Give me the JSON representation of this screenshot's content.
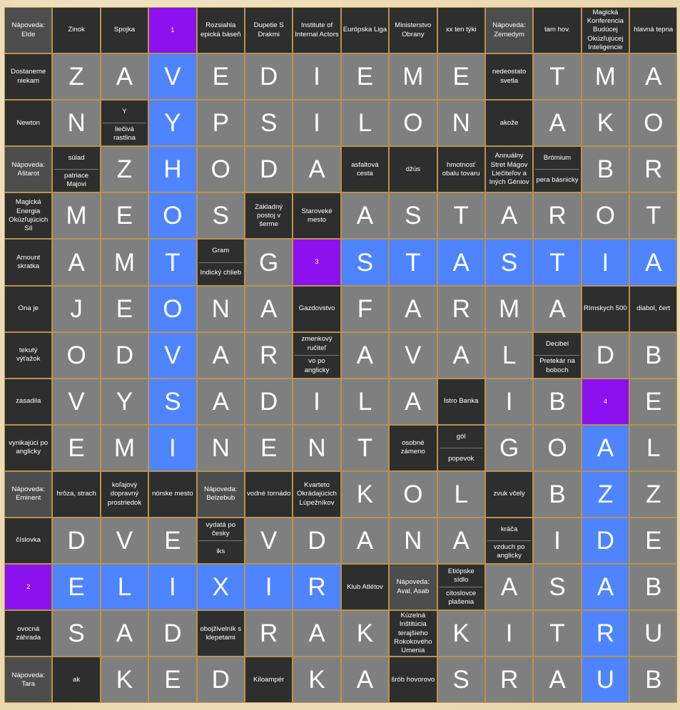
{
  "title": "",
  "rows": [
    [
      {
        "t": "hint",
        "text": "Nápoveda: Elde"
      },
      {
        "t": "clue",
        "text": "Zinok"
      },
      {
        "t": "clue",
        "text": "Spojka"
      },
      {
        "t": "num",
        "text": "1"
      },
      {
        "t": "clue",
        "text": "Rozsiahla epická báseň"
      },
      {
        "t": "clue",
        "text": "Dupetie S Drakmi"
      },
      {
        "t": "clue",
        "text": "Institute of Internal Actors"
      },
      {
        "t": "clue",
        "text": "Európska Liga"
      },
      {
        "t": "clue",
        "text": "Ministerstvo Obrany"
      },
      {
        "t": "clue",
        "text": "xx ten týki"
      },
      {
        "t": "hint",
        "text": "Nápoveda: Zemedym"
      },
      {
        "t": "clue",
        "text": "tam hov."
      },
      {
        "t": "clue",
        "text": "Magická Konferencia Budúcej Okúzľujúcej Inteligencie"
      },
      {
        "t": "clue",
        "text": "hlavná tepna"
      }
    ],
    [
      {
        "t": "clue",
        "text": "Dostaneme niekam"
      },
      {
        "t": "letter",
        "text": "Z"
      },
      {
        "t": "letter",
        "text": "A"
      },
      {
        "t": "letter",
        "text": "V",
        "hl": true
      },
      {
        "t": "letter",
        "text": "E"
      },
      {
        "t": "letter",
        "text": "D"
      },
      {
        "t": "letter",
        "text": "I"
      },
      {
        "t": "letter",
        "text": "E"
      },
      {
        "t": "letter",
        "text": "M"
      },
      {
        "t": "letter",
        "text": "E"
      },
      {
        "t": "clue",
        "text": "nedeostato svetla"
      },
      {
        "t": "letter",
        "text": "T"
      },
      {
        "t": "letter",
        "text": "M"
      },
      {
        "t": "letter",
        "text": "A"
      }
    ],
    [
      {
        "t": "clue",
        "text": "Newton"
      },
      {
        "t": "letter",
        "text": "N"
      },
      {
        "t": "split",
        "top": "Y",
        "bottom": "liečivá rastlina"
      },
      {
        "t": "letter",
        "text": "Y",
        "hl": true
      },
      {
        "t": "letter",
        "text": "P"
      },
      {
        "t": "letter",
        "text": "S"
      },
      {
        "t": "letter",
        "text": "I"
      },
      {
        "t": "letter",
        "text": "L"
      },
      {
        "t": "letter",
        "text": "O"
      },
      {
        "t": "letter",
        "text": "N"
      },
      {
        "t": "clue",
        "text": "akože"
      },
      {
        "t": "letter",
        "text": "A"
      },
      {
        "t": "letter",
        "text": "K"
      },
      {
        "t": "letter",
        "text": "O"
      }
    ],
    [
      {
        "t": "hint",
        "text": "Nápoveda: Aštarot"
      },
      {
        "t": "split",
        "top": "súlad",
        "bottom": "patriace Majovi"
      },
      {
        "t": "letter",
        "text": "Z"
      },
      {
        "t": "letter",
        "text": "H",
        "hl": true
      },
      {
        "t": "letter",
        "text": "O"
      },
      {
        "t": "letter",
        "text": "D"
      },
      {
        "t": "letter",
        "text": "A"
      },
      {
        "t": "clue",
        "text": "asfaltová cesta"
      },
      {
        "t": "clue",
        "text": "džús"
      },
      {
        "t": "clue",
        "text": "hmotnosť obalu tovaru"
      },
      {
        "t": "clue",
        "text": "Annuálny Stret Mágov Liečiteľov a Iných Géniov"
      },
      {
        "t": "split",
        "top": "Bróm​ium",
        "bottom": "pera básnicky"
      },
      {
        "t": "letter",
        "text": "B"
      },
      {
        "t": "letter",
        "text": "R"
      }
    ],
    [
      {
        "t": "clue",
        "text": "Magická Energia Okúzľujúcich Síl"
      },
      {
        "t": "letter",
        "text": "M"
      },
      {
        "t": "letter",
        "text": "E"
      },
      {
        "t": "letter",
        "text": "O",
        "hl": true
      },
      {
        "t": "letter",
        "text": "S"
      },
      {
        "t": "clue",
        "text": "Základný postoj v šerme"
      },
      {
        "t": "clue",
        "text": "Staroveké mesto"
      },
      {
        "t": "letter",
        "text": "A"
      },
      {
        "t": "letter",
        "text": "S"
      },
      {
        "t": "letter",
        "text": "T"
      },
      {
        "t": "letter",
        "text": "A"
      },
      {
        "t": "letter",
        "text": "R"
      },
      {
        "t": "letter",
        "text": "O"
      },
      {
        "t": "letter",
        "text": "T"
      }
    ],
    [
      {
        "t": "clue",
        "text": "Amount skratka"
      },
      {
        "t": "letter",
        "text": "A"
      },
      {
        "t": "letter",
        "text": "M"
      },
      {
        "t": "letter",
        "text": "T",
        "hl": true
      },
      {
        "t": "split",
        "top": "Gram",
        "bottom": "Indický chlieb"
      },
      {
        "t": "letter",
        "text": "G"
      },
      {
        "t": "num",
        "text": "3"
      },
      {
        "t": "letter",
        "text": "S",
        "hl": true
      },
      {
        "t": "letter",
        "text": "T",
        "hl": true
      },
      {
        "t": "letter",
        "text": "A",
        "hl": true
      },
      {
        "t": "letter",
        "text": "S",
        "hl": true
      },
      {
        "t": "letter",
        "text": "T",
        "hl": true
      },
      {
        "t": "letter",
        "text": "I",
        "hl": true
      },
      {
        "t": "letter",
        "text": "A",
        "hl": true
      }
    ],
    [
      {
        "t": "clue",
        "text": "Ona je"
      },
      {
        "t": "letter",
        "text": "J"
      },
      {
        "t": "letter",
        "text": "E"
      },
      {
        "t": "letter",
        "text": "O",
        "hl": true
      },
      {
        "t": "letter",
        "text": "N"
      },
      {
        "t": "letter",
        "text": "A"
      },
      {
        "t": "clue",
        "text": "Gazdovstvo"
      },
      {
        "t": "letter",
        "text": "F"
      },
      {
        "t": "letter",
        "text": "A"
      },
      {
        "t": "letter",
        "text": "R"
      },
      {
        "t": "letter",
        "text": "M"
      },
      {
        "t": "letter",
        "text": "A"
      },
      {
        "t": "clue",
        "text": "Rímskych 500"
      },
      {
        "t": "clue",
        "text": "diabol, čert"
      }
    ],
    [
      {
        "t": "clue",
        "text": "tekutý výťažok"
      },
      {
        "t": "letter",
        "text": "O"
      },
      {
        "t": "letter",
        "text": "D"
      },
      {
        "t": "letter",
        "text": "V",
        "hl": true
      },
      {
        "t": "letter",
        "text": "A"
      },
      {
        "t": "letter",
        "text": "R"
      },
      {
        "t": "split",
        "top": "zmenkový ručiteľ",
        "bottom": "vo po anglicky"
      },
      {
        "t": "letter",
        "text": "A"
      },
      {
        "t": "letter",
        "text": "V"
      },
      {
        "t": "letter",
        "text": "A"
      },
      {
        "t": "letter",
        "text": "L"
      },
      {
        "t": "split",
        "top": "Decibel",
        "bottom": "Pretekár na boboch"
      },
      {
        "t": "letter",
        "text": "D"
      },
      {
        "t": "letter",
        "text": "B"
      }
    ],
    [
      {
        "t": "clue",
        "text": "zasadila"
      },
      {
        "t": "letter",
        "text": "V"
      },
      {
        "t": "letter",
        "text": "Y"
      },
      {
        "t": "letter",
        "text": "S",
        "hl": true
      },
      {
        "t": "letter",
        "text": "A"
      },
      {
        "t": "letter",
        "text": "D"
      },
      {
        "t": "letter",
        "text": "I"
      },
      {
        "t": "letter",
        "text": "L"
      },
      {
        "t": "letter",
        "text": "A"
      },
      {
        "t": "clue",
        "text": "Istro Banka"
      },
      {
        "t": "letter",
        "text": "I"
      },
      {
        "t": "letter",
        "text": "B"
      },
      {
        "t": "num",
        "text": "4"
      },
      {
        "t": "letter",
        "text": "E"
      }
    ],
    [
      {
        "t": "clue",
        "text": "vynikajúci po anglicky"
      },
      {
        "t": "letter",
        "text": "E"
      },
      {
        "t": "letter",
        "text": "M"
      },
      {
        "t": "letter",
        "text": "I",
        "hl": true
      },
      {
        "t": "letter",
        "text": "N"
      },
      {
        "t": "letter",
        "text": "E"
      },
      {
        "t": "letter",
        "text": "N"
      },
      {
        "t": "letter",
        "text": "T"
      },
      {
        "t": "clue",
        "text": "osobné zámeno"
      },
      {
        "t": "split",
        "top": "gól",
        "bottom": "popevok"
      },
      {
        "t": "letter",
        "text": "G"
      },
      {
        "t": "letter",
        "text": "O"
      },
      {
        "t": "letter",
        "text": "A",
        "hl": true
      },
      {
        "t": "letter",
        "text": "L"
      }
    ],
    [
      {
        "t": "hint",
        "text": "Nápoveda: Eminent"
      },
      {
        "t": "clue",
        "text": "hrôza, strach"
      },
      {
        "t": "clue",
        "text": "koľajový dopravný prostriedok"
      },
      {
        "t": "clue",
        "text": "nórske mesto"
      },
      {
        "t": "hint",
        "text": "Nápoveda: Belzebub"
      },
      {
        "t": "clue",
        "text": "vodné tornádo"
      },
      {
        "t": "clue",
        "text": "Kvarteto Okrádajúcich Lúpežníkov"
      },
      {
        "t": "letter",
        "text": "K"
      },
      {
        "t": "letter",
        "text": "O"
      },
      {
        "t": "letter",
        "text": "L"
      },
      {
        "t": "clue",
        "text": "zvuk včely"
      },
      {
        "t": "letter",
        "text": "B"
      },
      {
        "t": "letter",
        "text": "Z",
        "hl": true
      },
      {
        "t": "letter",
        "text": "Z"
      }
    ],
    [
      {
        "t": "clue",
        "text": "číslovka"
      },
      {
        "t": "letter",
        "text": "D"
      },
      {
        "t": "letter",
        "text": "V"
      },
      {
        "t": "letter",
        "text": "E"
      },
      {
        "t": "split",
        "top": "vydatá po česky",
        "bottom": "iks"
      },
      {
        "t": "letter",
        "text": "V"
      },
      {
        "t": "letter",
        "text": "D"
      },
      {
        "t": "letter",
        "text": "A"
      },
      {
        "t": "letter",
        "text": "N"
      },
      {
        "t": "letter",
        "text": "A"
      },
      {
        "t": "split",
        "top": "kráča",
        "bottom": "vzduch po anglicky"
      },
      {
        "t": "letter",
        "text": "I"
      },
      {
        "t": "letter",
        "text": "D",
        "hl": true
      },
      {
        "t": "letter",
        "text": "E"
      }
    ],
    [
      {
        "t": "num",
        "text": "2"
      },
      {
        "t": "letter",
        "text": "E",
        "hl": true
      },
      {
        "t": "letter",
        "text": "L",
        "hl": true
      },
      {
        "t": "letter",
        "text": "I",
        "hl": true
      },
      {
        "t": "letter",
        "text": "X",
        "hl": true
      },
      {
        "t": "letter",
        "text": "I",
        "hl": true
      },
      {
        "t": "letter",
        "text": "R",
        "hl": true
      },
      {
        "t": "clue",
        "text": "Klub Atlétov"
      },
      {
        "t": "hint",
        "text": "Nápoveda: Aval, Asab"
      },
      {
        "t": "split",
        "top": "Etiópske sídlo",
        "bottom": "citoslovce plašenia"
      },
      {
        "t": "letter",
        "text": "A"
      },
      {
        "t": "letter",
        "text": "S"
      },
      {
        "t": "letter",
        "text": "A",
        "hl": true
      },
      {
        "t": "letter",
        "text": "B"
      }
    ],
    [
      {
        "t": "clue",
        "text": "ovocná záhrada"
      },
      {
        "t": "letter",
        "text": "S"
      },
      {
        "t": "letter",
        "text": "A"
      },
      {
        "t": "letter",
        "text": "D"
      },
      {
        "t": "clue",
        "text": "obojživelník s klepetami"
      },
      {
        "t": "letter",
        "text": "R"
      },
      {
        "t": "letter",
        "text": "A"
      },
      {
        "t": "letter",
        "text": "K"
      },
      {
        "t": "clue",
        "text": "Kúzelná Inštitúcia terajšieho Rokokového Umenia"
      },
      {
        "t": "letter",
        "text": "K"
      },
      {
        "t": "letter",
        "text": "I"
      },
      {
        "t": "letter",
        "text": "T"
      },
      {
        "t": "letter",
        "text": "R",
        "hl": true
      },
      {
        "t": "letter",
        "text": "U"
      }
    ],
    [
      {
        "t": "hint",
        "text": "Nápoveda: Tara"
      },
      {
        "t": "clue",
        "text": "ak"
      },
      {
        "t": "letter",
        "text": "K"
      },
      {
        "t": "letter",
        "text": "E"
      },
      {
        "t": "letter",
        "text": "D"
      },
      {
        "t": "clue",
        "text": "Kiloampér"
      },
      {
        "t": "letter",
        "text": "K"
      },
      {
        "t": "letter",
        "text": "A"
      },
      {
        "t": "clue",
        "text": "šrób hovorovo"
      },
      {
        "t": "letter",
        "text": "S"
      },
      {
        "t": "letter",
        "text": "R"
      },
      {
        "t": "letter",
        "text": "A"
      },
      {
        "t": "letter",
        "text": "U",
        "hl": true
      },
      {
        "t": "letter",
        "text": "B"
      }
    ]
  ]
}
